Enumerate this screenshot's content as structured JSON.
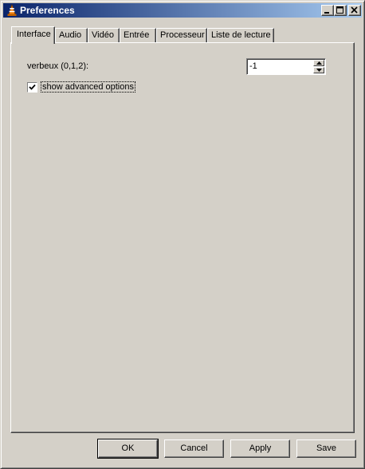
{
  "window": {
    "title": "Preferences"
  },
  "tabs": [
    {
      "label": "Interface",
      "active": true
    },
    {
      "label": "Audio"
    },
    {
      "label": "Vidéo"
    },
    {
      "label": "Entrée"
    },
    {
      "label": "Processeur"
    },
    {
      "label": "Liste de lecture"
    }
  ],
  "interface": {
    "verbose_label": "verbeux (0,1,2):",
    "verbose_value": "-1",
    "advanced_label": "show advanced options",
    "advanced_checked": true
  },
  "buttons": {
    "ok": "OK",
    "cancel": "Cancel",
    "apply": "Apply",
    "save": "Save"
  },
  "colors": {
    "titlebar_start": "#0a246a",
    "titlebar_end": "#a6caf0",
    "face": "#d4d0c8"
  }
}
